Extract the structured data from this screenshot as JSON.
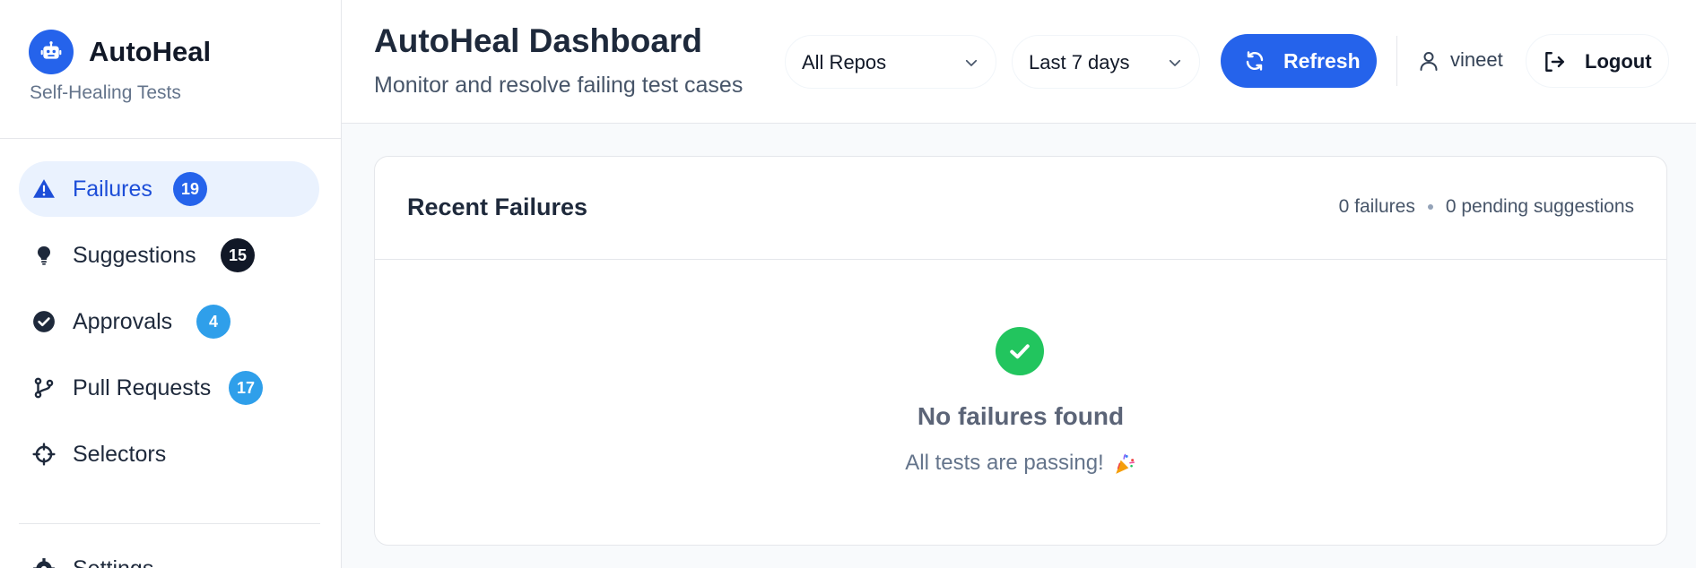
{
  "brand": {
    "name": "AutoHeal",
    "subtitle": "Self-Healing Tests",
    "icon": "robot-icon"
  },
  "sidebar": {
    "items": [
      {
        "label": "Failures",
        "badge": "19",
        "icon": "warning-icon",
        "active": true
      },
      {
        "label": "Suggestions",
        "badge": "15",
        "icon": "lightbulb-icon"
      },
      {
        "label": "Approvals",
        "badge": "4",
        "icon": "check-circle-icon"
      },
      {
        "label": "Pull Requests",
        "badge": "17",
        "icon": "git-branch-icon"
      },
      {
        "label": "Selectors",
        "badge": null,
        "icon": "crosshair-icon"
      }
    ],
    "settings_label": "Settings"
  },
  "header": {
    "title": "AutoHeal Dashboard",
    "subtitle": "Monitor and resolve failing test cases",
    "repo_select": "All Repos",
    "range_select": "Last 7 days",
    "refresh_label": "Refresh",
    "user_name": "vineet",
    "logout_label": "Logout"
  },
  "card": {
    "title": "Recent Failures",
    "failures_count": "0 failures",
    "pending_suggestions": "0 pending suggestions",
    "empty_title": "No failures found",
    "empty_subtitle": "All tests are passing!"
  },
  "colors": {
    "accent": "#2563eb",
    "active_bg": "#eaf2fe",
    "success": "#22c55e",
    "badge_dark": "#111827",
    "badge_sky": "#2f9fea"
  }
}
